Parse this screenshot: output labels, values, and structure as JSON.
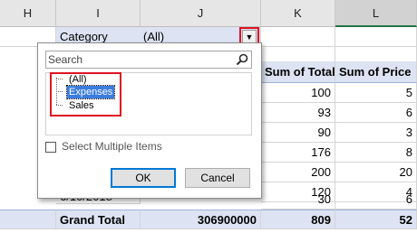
{
  "columns": [
    "H",
    "I",
    "J",
    "K",
    "L"
  ],
  "filter_row": {
    "label": "Category",
    "value": "(All)"
  },
  "pivot_header": {
    "sum_total": "Sum of Total",
    "sum_price": "Sum of Price"
  },
  "rows": [
    {
      "total": "100",
      "price": "5"
    },
    {
      "total": "93",
      "price": "6"
    },
    {
      "total": "90",
      "price": "3"
    },
    {
      "total": "176",
      "price": "8"
    },
    {
      "total": "200",
      "price": "20"
    },
    {
      "total": "120",
      "price": "4"
    },
    {
      "total": "30",
      "price": "6"
    }
  ],
  "partial_row_label": "6/10/2018",
  "grand_total": {
    "label": "Grand Total",
    "value": "306900000",
    "total": "809",
    "price": "52"
  },
  "popup": {
    "search_placeholder": "Search",
    "items": [
      "(All)",
      "Expenses",
      "Sales"
    ],
    "selected_item": "Expenses",
    "multi_label": "Select Multiple Items",
    "ok_label": "OK",
    "cancel_label": "Cancel"
  },
  "colors": {
    "highlight": "#e0121f",
    "selection": "#3b7dde",
    "pivot_shade": "#dde3f3"
  }
}
